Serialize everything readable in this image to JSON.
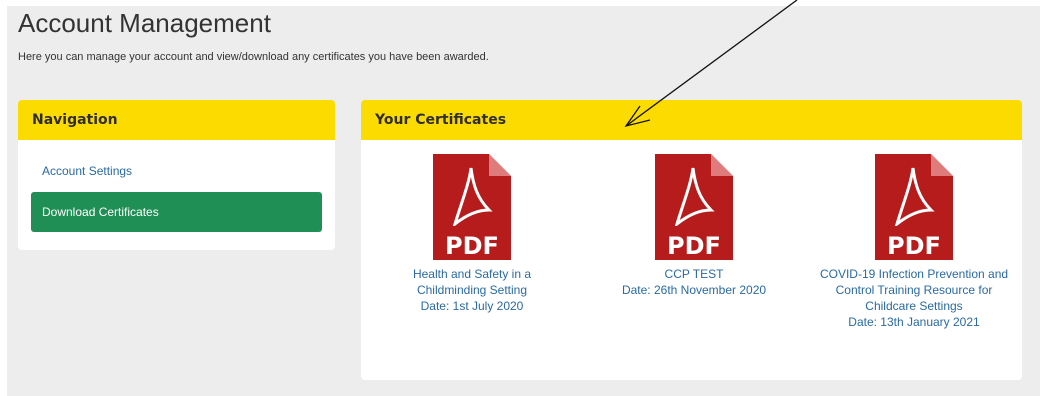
{
  "page": {
    "title": "Account Management",
    "intro": "Here you can manage your account and view/download any certificates you have been awarded."
  },
  "navigation": {
    "heading": "Navigation",
    "items": [
      {
        "label": "Account Settings",
        "active": false
      },
      {
        "label": "Download Certificates",
        "active": true
      }
    ]
  },
  "certificates": {
    "heading": "Your Certificates",
    "icon_label": "PDF",
    "items": [
      {
        "name": "Health and Safety in a Childminding Setting",
        "date": "Date: 1st July 2020"
      },
      {
        "name": "CCP TEST",
        "date": "Date: 26th November 2020"
      },
      {
        "name": "COVID-19 Infection Prevention and Control Training Resource for Childcare Settings",
        "date": "Date: 13th January 2021"
      }
    ]
  },
  "colors": {
    "header_yellow": "#fcdc00",
    "active_green": "#1f8f55",
    "link_blue": "#2a6aa0",
    "pdf_red": "#b71c1c"
  }
}
